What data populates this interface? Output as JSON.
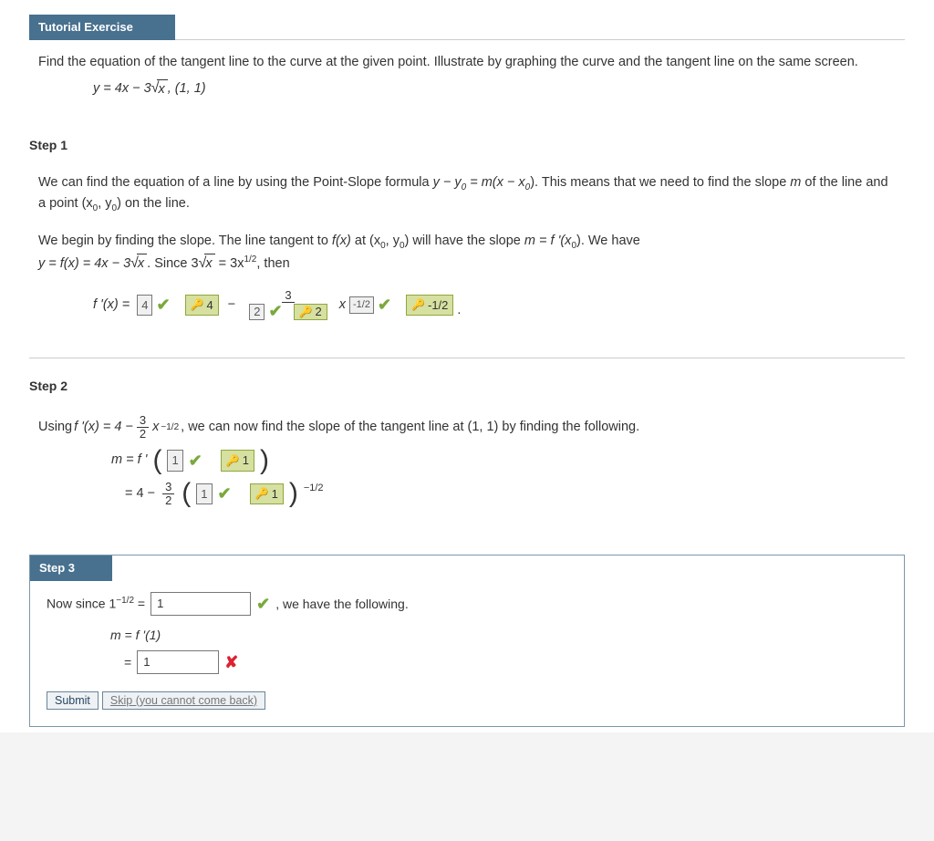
{
  "header": {
    "title": "Tutorial Exercise"
  },
  "problem": {
    "text": "Find the equation of the tangent line to the curve at the given point. Illustrate by graphing the curve and the tangent line on the same screen.",
    "equation_lhs": "y = 4x − 3",
    "equation_radicand": "x",
    "equation_point": ",  (1, 1)"
  },
  "step1": {
    "label": "Step 1",
    "para1_a": "We can find the equation of a line by using the Point-Slope formula ",
    "para1_formula": "y − y",
    "para1_formula_mid": " = m(x − x",
    "para1_b": ").  This means that we need to find the slope ",
    "para1_c": " of the line and a point  (x",
    "para1_d": ", y",
    "para1_e": ")  on the line.",
    "para2_a": "We begin by finding the slope. The line tangent to ",
    "para2_b": " at  (x",
    "para2_c": ", y",
    "para2_d": ")  will have the slope  ",
    "para2_e": " = f '(x",
    "para2_f": ").  We have ",
    "para2_g": " = f(x) = 4x − 3",
    "para2_h": ".  Since  3",
    "para2_i": " = 3x",
    "para2_j": ",  then",
    "fprime_lhs": "f '(x) = ",
    "ans1": "4",
    "key1": "4",
    "ans2": "2",
    "key2": "2",
    "frac_num": "3",
    "exp1": "-1/2",
    "key_exp": "-1/2",
    "m_var": "m"
  },
  "step2": {
    "label": "Step 2",
    "intro_a": "Using  ",
    "intro_b": "f '(x) = 4 − ",
    "frac_num": "3",
    "frac_den": "2",
    "intro_c": "x",
    "intro_exp": "−1/2",
    "intro_d": ",  we can now find the slope of the tangent line at (1, 1) by finding the following.",
    "line1_lhs": "m  =  f '",
    "ans1": "1",
    "key1": "1",
    "line2_lhs": "=  4 − ",
    "ans2": "1",
    "key2": "1",
    "line2_exp": "−1/2"
  },
  "step3": {
    "label": "Step 3",
    "line1_a": "Now since  1",
    "line1_exp": "−1/2",
    "line1_b": " = ",
    "ans1": "1",
    "line1_c": ",  we have the following.",
    "line2": "m  =  f '(1)",
    "line3_lhs": "= ",
    "ans2": "1",
    "submit": "Submit",
    "skip": "Skip (you cannot come back)"
  }
}
